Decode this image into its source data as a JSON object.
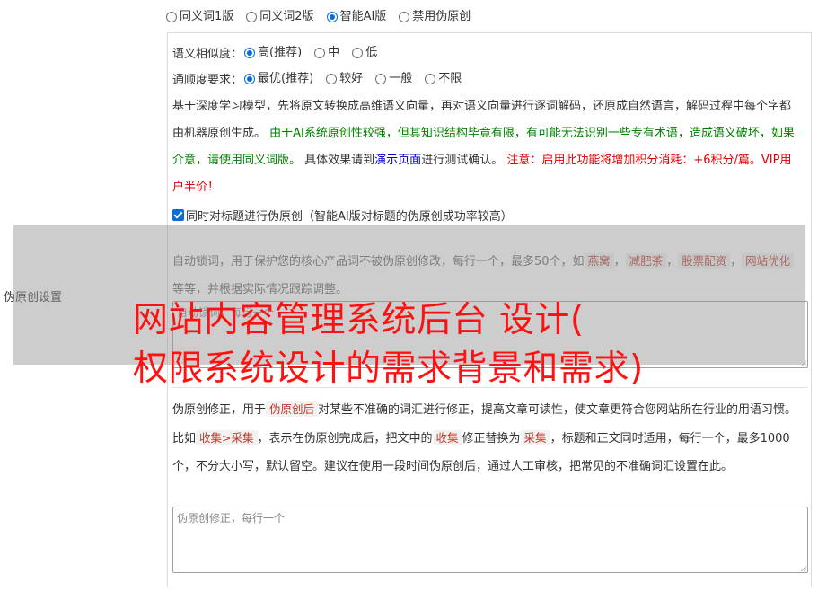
{
  "versions": [
    {
      "label": "同义词1版",
      "checked": false
    },
    {
      "label": "同义词2版",
      "checked": false
    },
    {
      "label": "智能AI版",
      "checked": true
    },
    {
      "label": "禁用伪原创",
      "checked": false
    }
  ],
  "similarity": {
    "label": "语义相似度：",
    "options": [
      {
        "label": "高(推荐)",
        "checked": true
      },
      {
        "label": "中",
        "checked": false
      },
      {
        "label": "低",
        "checked": false
      }
    ]
  },
  "fluency": {
    "label": "通顺度要求：",
    "options": [
      {
        "label": "最优(推荐)",
        "checked": true
      },
      {
        "label": "较好",
        "checked": false
      },
      {
        "label": "一般",
        "checked": false
      },
      {
        "label": "不限",
        "checked": false
      }
    ]
  },
  "description": {
    "p1": "基于深度学习模型，先将原文转换成高维语义向量，再对语义向量进行逐词解码，还原成自然语言，解码过程中每个字都由机器原创生成。",
    "p2_green": "由于AI系统原创性较强，但其知识结构毕竟有限，有可能无法识别一些专有术语，造成语义破坏，如果介意，请使用同义词版。",
    "p3": "具体效果请到",
    "link": "演示页面",
    "p4": "进行测试确认。",
    "p5_red": "注意：启用此功能将增加积分消耗：+6积分/篇。VIP用户半价！"
  },
  "title_checkbox": {
    "label": "同时对标题进行伪原创（智能AI版对标题的伪原创成功率较高）",
    "checked": true
  },
  "side_label": "伪原创设置",
  "lock": {
    "text_a": "自动锁词，用于保护您的核心产品词不被伪原创修改，每行一个，最多50个，如",
    "tags": [
      "燕窝",
      "减肥茶",
      "股票配资",
      "网站优化"
    ],
    "sep": "，",
    "text_b": "等等，并根据实际情况跟踪调整。",
    "placeholder": "自动锁词，每行一个"
  },
  "fix": {
    "p1": "伪原创修正，用于",
    "tag1": "伪原创后",
    "p2": "对某些不准确的词汇进行修正，提高文章可读性，使文章更符合您网站所在行业的用语习惯。比如",
    "tag2": "收集>采集",
    "p3": "，表示在伪原创完成后，把文中的",
    "tag3": "收集",
    "p4": "修正替换为",
    "tag4": "采集",
    "p5": "，标题和正文同时适用，每行一个，最多1000个，不分大小写，默认留空。建议在使用一段时间伪原创后，通过人工审核，把常见的不准确词汇设置在此。",
    "placeholder": "伪原创修正，每行一个"
  },
  "overlay": {
    "line1": "网站内容管理系统后台 设计(",
    "line2": "权限系统设计的需求背景和需求)"
  }
}
